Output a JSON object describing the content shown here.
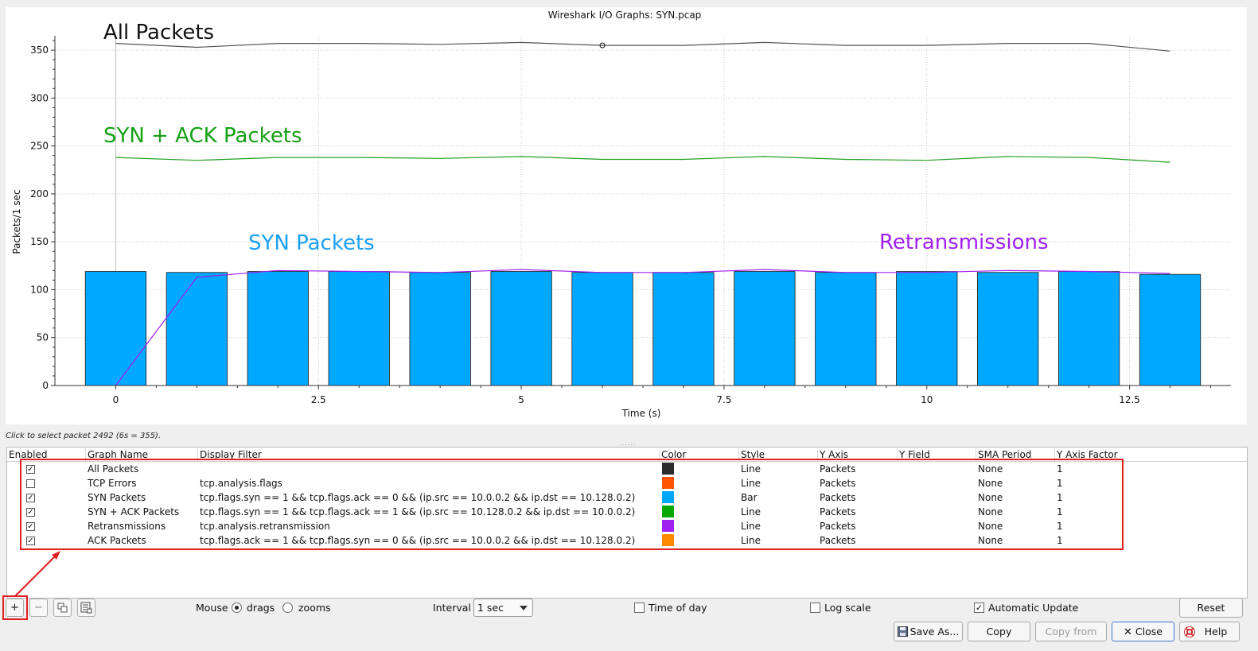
{
  "chart_data": {
    "type": "line",
    "title": "Wireshark I/O Graphs: SYN.pcap",
    "xlabel": "Time (s)",
    "ylabel": "Packets/1 sec",
    "xlim": [
      -0.75,
      13.75
    ],
    "ylim": [
      0,
      365
    ],
    "x_ticks": [
      "0",
      "2.5",
      "5",
      "7.5",
      "10",
      "12.5"
    ],
    "y_ticks": [
      "0",
      "50",
      "100",
      "150",
      "200",
      "250",
      "300",
      "350"
    ],
    "x": [
      0,
      1,
      2,
      3,
      4,
      5,
      6,
      7,
      8,
      9,
      10,
      11,
      12,
      13
    ],
    "series": [
      {
        "name": "All Packets",
        "type": "line",
        "color": "#555555",
        "values": [
          357,
          353,
          357,
          357,
          356,
          358,
          355,
          355,
          358,
          355,
          355,
          357,
          357,
          349
        ]
      },
      {
        "name": "SYN + ACK Packets",
        "type": "line",
        "color": "#22a022",
        "values": [
          238,
          235,
          238,
          238,
          237,
          239,
          236,
          236,
          239,
          236,
          235,
          239,
          238,
          233
        ]
      },
      {
        "name": "SYN Packets",
        "type": "bar",
        "color": "#00a8ff",
        "values": [
          119,
          118,
          119,
          119,
          118,
          119,
          118,
          118,
          119,
          118,
          119,
          118,
          119,
          116
        ]
      },
      {
        "name": "Retransmissions",
        "type": "line",
        "color": "#a020f0",
        "values": [
          0,
          113,
          120,
          119,
          118,
          121,
          118,
          118,
          121,
          118,
          118,
          120,
          119,
          117
        ]
      }
    ],
    "annotations": [
      {
        "text": "All Packets",
        "color": "#111111"
      },
      {
        "text": "SYN + ACK Packets",
        "color": "#16a016"
      },
      {
        "text": "SYN Packets",
        "color": "#1aa0f0"
      },
      {
        "text": "Retransmissions",
        "color": "#a020f0"
      }
    ],
    "marker": {
      "x": 6,
      "y": 355
    },
    "grid": true
  },
  "status": "Click to select packet 2492 (6s = 355).",
  "splitter": "......",
  "table": {
    "headers": [
      "Enabled",
      "Graph Name",
      "Display Filter",
      "Color",
      "Style",
      "Y Axis",
      "Y Field",
      "SMA Period",
      "Y Axis Factor"
    ],
    "rows": [
      {
        "enabled": true,
        "check": "✓",
        "name": "All Packets",
        "filter": "",
        "color": "#2b2b2b",
        "style": "Line",
        "yaxis": "Packets",
        "yfield": "",
        "sma": "None",
        "factor": "1"
      },
      {
        "enabled": false,
        "check": "",
        "name": "TCP Errors",
        "filter": "tcp.analysis.flags",
        "color": "#ff5500",
        "style": "Line",
        "yaxis": "Packets",
        "yfield": "",
        "sma": "None",
        "factor": "1"
      },
      {
        "enabled": true,
        "check": "✓",
        "name": "SYN Packets",
        "filter": "tcp.flags.syn == 1 && tcp.flags.ack == 0 && (ip.src == 10.0.0.2 && ip.dst == 10.128.0.2)",
        "color": "#00a8ff",
        "style": "Bar",
        "yaxis": "Packets",
        "yfield": "",
        "sma": "None",
        "factor": "1"
      },
      {
        "enabled": true,
        "check": "✓",
        "name": "SYN + ACK Packets",
        "filter": "tcp.flags.syn == 1 && tcp.flags.ack == 1 && (ip.src == 10.128.0.2 && ip.dst == 10.0.0.2)",
        "color": "#00a800",
        "style": "Line",
        "yaxis": "Packets",
        "yfield": "",
        "sma": "None",
        "factor": "1"
      },
      {
        "enabled": true,
        "check": "✓",
        "name": "Retransmissions",
        "filter": "tcp.analysis.retransmission",
        "color": "#a020f0",
        "style": "Line",
        "yaxis": "Packets",
        "yfield": "",
        "sma": "None",
        "factor": "1"
      },
      {
        "enabled": true,
        "check": "✓",
        "name": "ACK Packets",
        "filter": "tcp.flags.ack == 1 && tcp.flags.syn == 0 && (ip.src == 10.0.0.2 && ip.dst == 10.128.0.2)",
        "color": "#ff8a00",
        "style": "Line",
        "yaxis": "Packets",
        "yfield": "",
        "sma": "None",
        "factor": "1"
      }
    ]
  },
  "toolbar": {
    "add": "+",
    "remove": "−",
    "copy_icon": "copy-graph-icon",
    "clear_icon": "clear-graphs-icon",
    "mouse_label": "Mouse",
    "drags_label": "drags",
    "zooms_label": "zooms",
    "mouse_mode": "drags",
    "interval_label": "Interval",
    "interval_value": "1 sec",
    "time_of_day_label": "Time of day",
    "time_of_day": false,
    "log_scale_label": "Log scale",
    "log_scale": false,
    "auto_update_label": "Automatic Update",
    "auto_update": true,
    "auto_update_check": "✓",
    "reset": "Reset"
  },
  "buttons": {
    "save_as": "Save As...",
    "copy": "Copy",
    "copy_from": "Copy from",
    "close": "Close",
    "help": "Help"
  }
}
